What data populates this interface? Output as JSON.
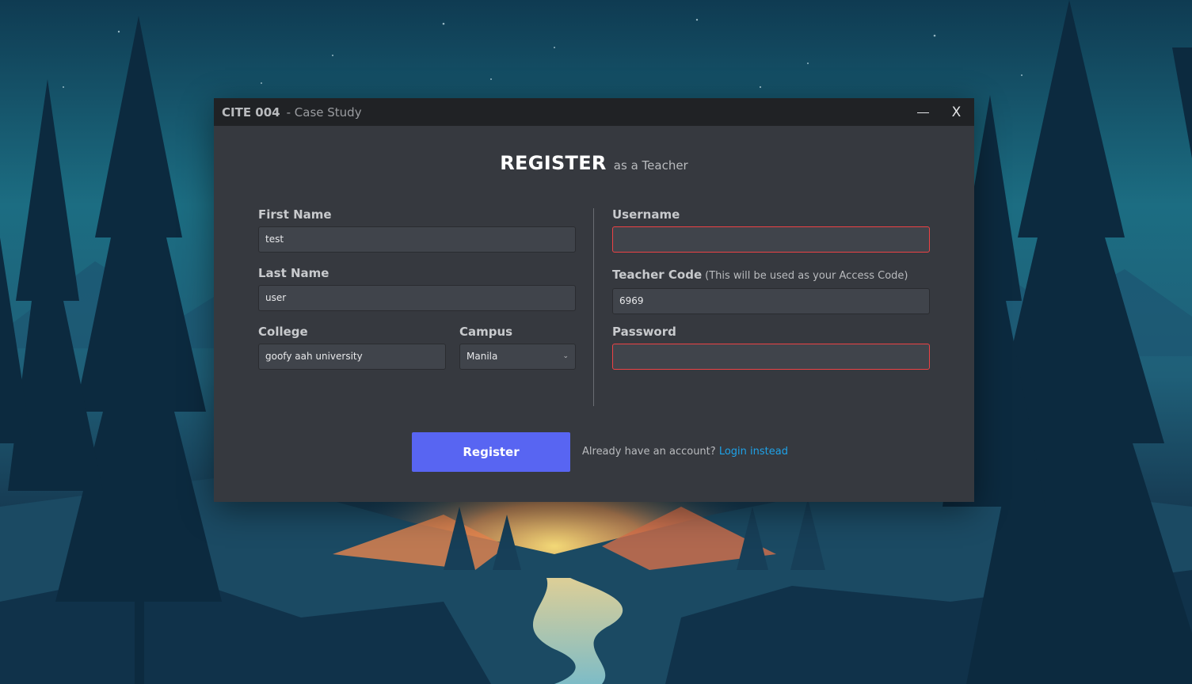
{
  "titlebar": {
    "app_name": "CITE 004",
    "subtitle": "- Case Study",
    "minimize_icon": "minimize-icon",
    "close_label": "X"
  },
  "heading": {
    "main": "REGISTER",
    "sub": "as a Teacher"
  },
  "form": {
    "first_name": {
      "label": "First Name",
      "value": "test"
    },
    "last_name": {
      "label": "Last Name",
      "value": "user"
    },
    "college": {
      "label": "College",
      "value": "goofy aah university"
    },
    "campus": {
      "label": "Campus",
      "value": "Manila"
    },
    "username": {
      "label": "Username",
      "value": ""
    },
    "teacher_code": {
      "label": "Teacher Code",
      "hint": "(This will be used as your Access Code)",
      "value": "6969"
    },
    "password": {
      "label": "Password",
      "value": ""
    }
  },
  "actions": {
    "register_label": "Register",
    "already_text": "Already have an account?",
    "login_label": "Login instead"
  },
  "colors": {
    "window_bg": "#36393f",
    "titlebar_bg": "#202225",
    "input_bg": "#40444b",
    "accent": "#5865f2",
    "link": "#1ea2e8",
    "error_border": "#ed4245"
  }
}
